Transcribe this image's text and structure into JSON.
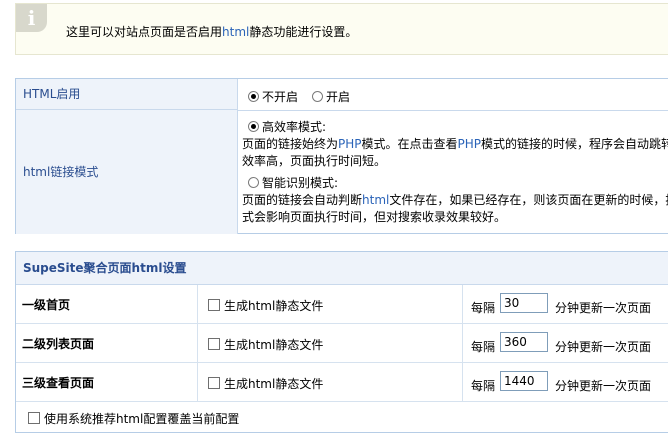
{
  "info": {
    "badge": "i",
    "text_prefix": "这里可以对站点页面是否启用",
    "text_html": "html",
    "text_suffix": "静态功能进行设置。"
  },
  "html_settings": {
    "enable_label": "HTML启用",
    "enable_options": [
      {
        "label": "不开启",
        "selected": true
      },
      {
        "label": "开启",
        "selected": false
      }
    ],
    "mode_label": "html链接模式",
    "mode_options": [
      {
        "label": "高效率模式:",
        "selected": true,
        "desc_line1_a": "页面的链接始终为",
        "desc_line1_php": "PHP",
        "desc_line1_b": "模式。在点击查看",
        "desc_line1_php2": "PHP",
        "desc_line1_c": "模式的链接的时候，程序会自动跳转",
        "desc_line2": "效率高，页面执行时间短。"
      },
      {
        "label": "智能识别模式:",
        "selected": false,
        "desc_line1_a": "页面的链接会自动判断",
        "desc_line1_html": "html",
        "desc_line1_b": "文件存在，如果已经存在，则该页面在更新的时候，按",
        "desc_line2": "式会影响页面执行时间，但对搜索收录效果较好。"
      }
    ]
  },
  "supesite": {
    "header": "SupeSite聚合页面html设置",
    "rows": [
      {
        "name": "一级首页",
        "check_label": "生成html静态文件",
        "interval_prefix": "每隔",
        "interval_value": "30",
        "interval_suffix": "分钟更新一次页面"
      },
      {
        "name": "二级列表页面",
        "check_label": "生成html静态文件",
        "interval_prefix": "每隔",
        "interval_value": "360",
        "interval_suffix": "分钟更新一次页面"
      },
      {
        "name": "三级查看页面",
        "check_label": "生成html静态文件",
        "interval_prefix": "每隔",
        "interval_value": "1440",
        "interval_suffix": "分钟更新一次页面"
      }
    ],
    "footer_check_label": "使用系统推荐html配置覆盖当前配置"
  },
  "colors": {
    "accent": "#2a63b8",
    "label_bg": "#eef3fa",
    "border": "#b6cde6"
  }
}
